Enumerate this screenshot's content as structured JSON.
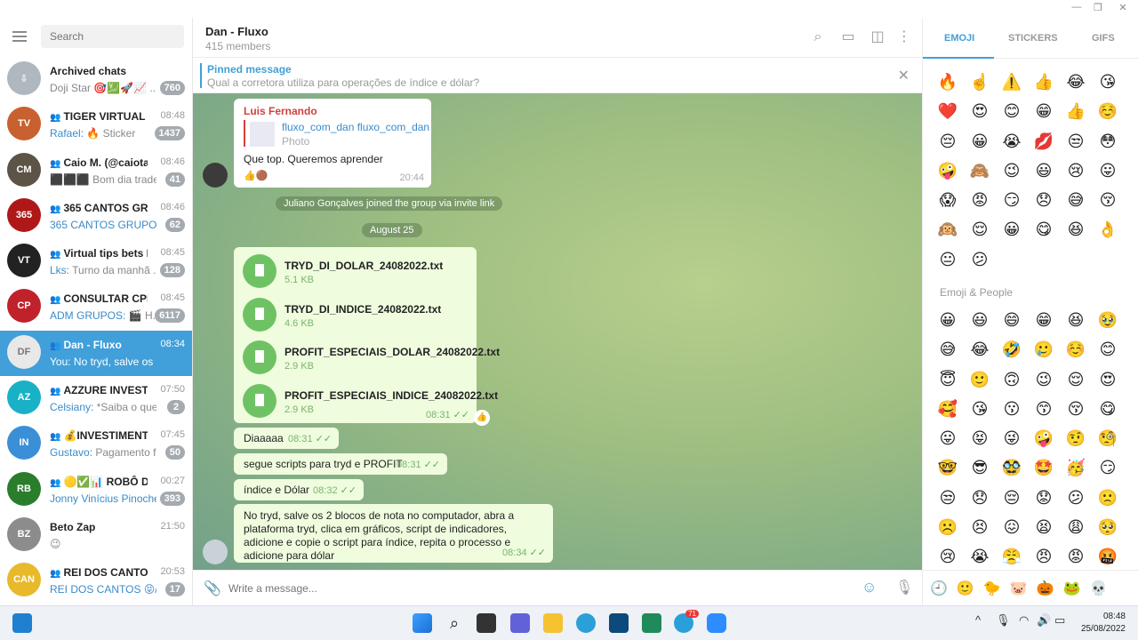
{
  "window": {
    "minimize": "—",
    "restore": "❐",
    "close": "✕"
  },
  "sidebar": {
    "search_placeholder": "Search",
    "chats": [
      {
        "name": "Archived chats",
        "time": "",
        "sender": "",
        "preview": "Doji Star 🎯💹🚀📈 ...",
        "badge": "760",
        "avatar_color": "#b0b8bf",
        "avatar_text": "⇩"
      },
      {
        "name": "TIGER VIRTUAL",
        "time": "08:48",
        "sender": "Rafael:",
        "preview": " 🔥 Sticker",
        "badge": "1437",
        "avatar_color": "#c9602f",
        "avatar_text": "TV"
      },
      {
        "name": "Caio M. (@caiotape...",
        "time": "08:46",
        "sender": "",
        "preview": "⬛⬛⬛ Bom dia trade...",
        "badge": "41",
        "avatar_color": "#5d5347",
        "avatar_text": "CM"
      },
      {
        "name": "365 CANTOS GRUP...",
        "time": "08:46",
        "sender": "365 CANTOS GRUPO(02)...",
        "preview": "",
        "badge": "62",
        "avatar_color": "#b01818",
        "avatar_text": "365"
      },
      {
        "name": "Virtual tips bets Free",
        "time": "08:45",
        "sender": "Lks:",
        "preview": " Turno da manhã ...",
        "badge": "128",
        "avatar_color": "#222222",
        "avatar_text": "VT"
      },
      {
        "name": "CONSULTAR CPF G...",
        "time": "08:45",
        "sender": "ADM GRUPOS:",
        "preview": " 🎬 H...",
        "badge": "6117",
        "avatar_color": "#c0222b",
        "avatar_text": "CP"
      },
      {
        "name": "Dan - Fluxo",
        "time": "08:34",
        "sender": "",
        "preview": "You: No tryd, salve os 2 bloc...",
        "badge": "",
        "avatar_color": "#e8e8e8",
        "avatar_text": "DF"
      },
      {
        "name": "AZZURE INVEST CR...",
        "time": "07:50",
        "sender": "Celsiany:",
        "preview": " *Saiba o que v...",
        "badge": "2",
        "avatar_color": "#19b1c6",
        "avatar_text": "AZ"
      },
      {
        "name": "💰INVESTIMENTO...",
        "time": "07:45",
        "sender": "Gustavo:",
        "preview": " Pagamento fei...",
        "badge": "50",
        "avatar_color": "#3b8fd6",
        "avatar_text": "IN"
      },
      {
        "name": "🟡✅📊 ROBÔ D...",
        "time": "00:27",
        "sender": "Jonny Vinícius Pinoche...",
        "preview": "",
        "badge": "393",
        "avatar_color": "#2a7d2a",
        "avatar_text": "RB"
      },
      {
        "name": "Beto Zap",
        "time": "21:50",
        "sender": "",
        "preview": "😉",
        "badge": "",
        "avatar_color": "#8c8c8c",
        "avatar_text": "BZ"
      },
      {
        "name": "REI DOS CANTOS ...",
        "time": "20:53",
        "sender": "REI DOS CANTOS 😝/ F...",
        "preview": "",
        "badge": "17",
        "avatar_color": "#e7b92b",
        "avatar_text": "CAN"
      }
    ]
  },
  "header": {
    "title": "Dan - Fluxo",
    "subtitle": "415 members"
  },
  "pinned": {
    "title": "Pinned message",
    "text": "Qual a corretora utiliza para operações de índice e dólar?"
  },
  "messages": {
    "m1": {
      "author": "Luis Fernando",
      "link_title": "fluxo_com_dan fluxo_com_dan",
      "link_sub": "Photo",
      "text": "Que top.  Queremos aprender",
      "time": "20:44"
    },
    "service1": "Juliano Gonçalves joined the group via invite link",
    "date": "August 25",
    "files": [
      {
        "name": "TRYD_DI_DOLAR_24082022.txt",
        "size": "5.1 KB"
      },
      {
        "name": "TRYD_DI_INDICE_24082022.txt",
        "size": "4.6 KB"
      },
      {
        "name": "PROFIT_ESPECIAIS_DOLAR_24082022.txt",
        "size": "2.9 KB"
      },
      {
        "name": "PROFIT_ESPECIAIS_INDICE_24082022.txt",
        "size": "2.9 KB"
      }
    ],
    "files_time": "08:31",
    "m2": {
      "text": "Diaaaaa",
      "time": "08:31"
    },
    "m3": {
      "text": "segue scripts para tryd e PROFIT",
      "time": "08:31"
    },
    "m4": {
      "text": "índice e Dólar",
      "time": "08:32"
    },
    "m5": {
      "text": "No tryd, salve os 2 blocos de nota no computador, abra a plataforma tryd, clica em gráficos, script de indicadores, adicione e copie o script para índice, repita o processo e adicione para dólar",
      "time": "08:34"
    }
  },
  "composer": {
    "placeholder": "Write a message..."
  },
  "emoji_panel": {
    "tabs": [
      "EMOJI",
      "STICKERS",
      "GIFS"
    ],
    "recent": [
      "🔥",
      "☝️",
      "⚠️",
      "👍",
      "😂",
      "😘",
      "❤️",
      "😍",
      "😊",
      "😁",
      "👍",
      "☺️",
      "😔",
      "😀",
      "😭",
      "💋",
      "😒",
      "😳",
      "🤪",
      "🙈",
      "😉",
      "😃",
      "😢",
      "😛",
      "😱",
      "😡",
      "😏",
      "😞",
      "😅",
      "😚",
      "🙉",
      "😌",
      "😀",
      "😋",
      "😆",
      "👌",
      "😐",
      "😕"
    ],
    "section": "Emoji & People",
    "people": [
      "😀",
      "😃",
      "😄",
      "😁",
      "😆",
      "🥹",
      "😅",
      "😂",
      "🤣",
      "🥲",
      "☺️",
      "😊",
      "😇",
      "🙂",
      "🙃",
      "😉",
      "😌",
      "😍",
      "🥰",
      "😘",
      "😗",
      "😙",
      "😚",
      "😋",
      "😛",
      "😝",
      "😜",
      "🤪",
      "🤨",
      "🧐",
      "🤓",
      "😎",
      "🥸",
      "🤩",
      "🥳",
      "😏",
      "😒",
      "😞",
      "😔",
      "😟",
      "😕",
      "🙁",
      "☹️",
      "😣",
      "😖",
      "😫",
      "😩",
      "🥺",
      "😢",
      "😭",
      "😤",
      "😠",
      "😡",
      "🤬"
    ],
    "bottom_icons": [
      "🕘",
      "🙂",
      "🐤",
      "🐷",
      "🎃",
      "🐸",
      "💀"
    ]
  },
  "taskbar": {
    "time": "08:48",
    "date": "25/08/2022",
    "telegram_badge": "71"
  }
}
